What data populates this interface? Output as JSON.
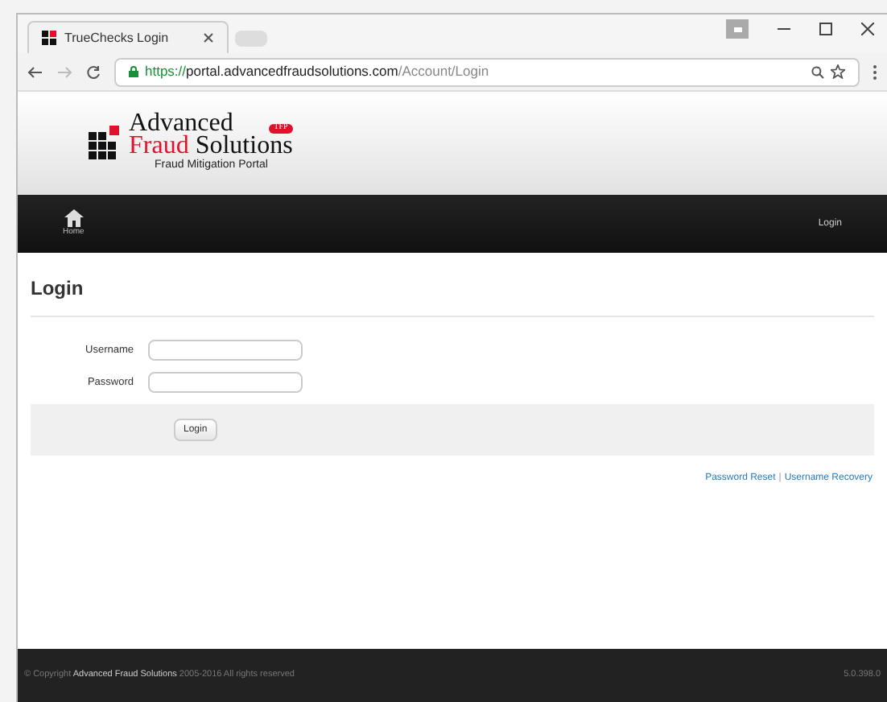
{
  "browser": {
    "tab_title": "TrueChecks Login",
    "url_scheme": "https://",
    "url_host": "portal.advancedfraudsolutions.com",
    "url_path": "/Account/Login"
  },
  "header": {
    "logo_line1": "Advanced",
    "logo_red": "Fraud",
    "logo_rest": "Solutions",
    "logo_badge": "TFP",
    "tagline": "Fraud Mitigation Portal"
  },
  "nav": {
    "home": "Home",
    "login": "Login"
  },
  "page_title": "Login",
  "fields": [
    {
      "label": "Username"
    },
    {
      "label": "Password"
    }
  ],
  "submit": "Login",
  "links": [
    "Password Reset",
    "Username Recovery"
  ],
  "link_separator": "|",
  "footer": {
    "copyright": "© Copyright **Advanced Fraud Solutions** 2005-2016 All rights reserved",
    "version": "5.0.398.0"
  }
}
